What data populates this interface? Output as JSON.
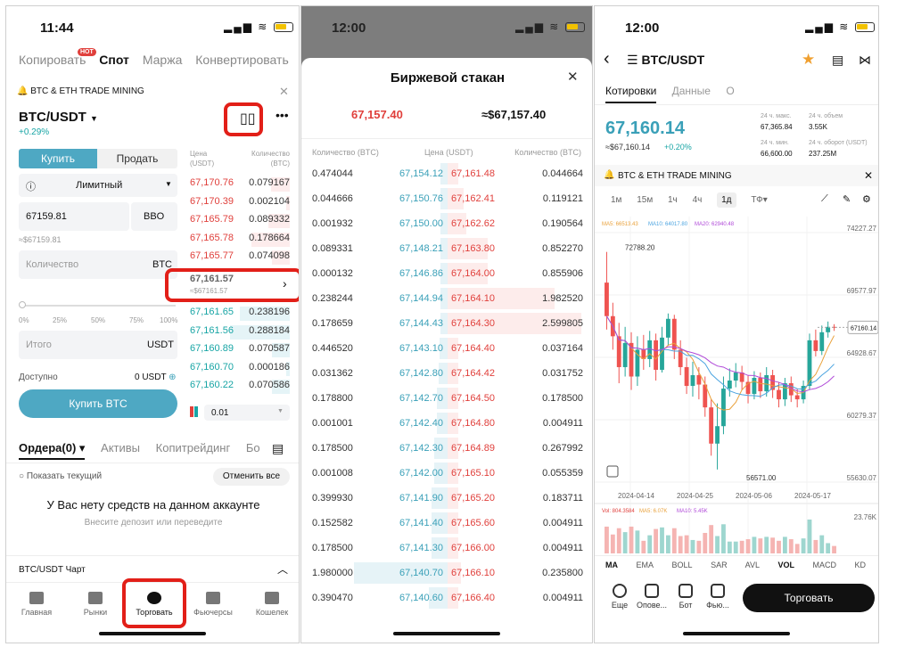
{
  "panel1": {
    "status": {
      "time": "11:44"
    },
    "nav": {
      "tabs": [
        "Копировать",
        "Спот",
        "Маржа",
        "Конвертировать"
      ],
      "active": "Спот",
      "hot": "HOT"
    },
    "banner": {
      "text": "BTC & ETH TRADE MINING"
    },
    "pair": {
      "name": "BTC/USDT",
      "change": "+0.29%"
    },
    "buy_sell": {
      "buy": "Купить",
      "sell": "Продать"
    },
    "order_type": "Лимитный",
    "price_input": {
      "value": "67159.81",
      "bbo": "BBO",
      "approx": "≈$67159.81"
    },
    "qty_input": {
      "placeholder": "Количество",
      "unit": "BTC"
    },
    "slider": {
      "marks": [
        "0%",
        "25%",
        "50%",
        "75%",
        "100%"
      ]
    },
    "total": {
      "placeholder": "Итого",
      "unit": "USDT"
    },
    "available": {
      "label": "Доступно",
      "value": "0 USDT"
    },
    "buy_button": "Купить BTC",
    "orderbook": {
      "header_price": "Цена (USDT)",
      "header_qty": "Количество (BTC)",
      "asks": [
        {
          "price": "67,170.76",
          "qty": "0.079167"
        },
        {
          "price": "67,170.39",
          "qty": "0.002104"
        },
        {
          "price": "67,165.79",
          "qty": "0.089332"
        },
        {
          "price": "67,165.78",
          "qty": "0.178664"
        },
        {
          "price": "67,165.77",
          "qty": "0.074098"
        }
      ],
      "mid": {
        "price": "67,161.57",
        "approx": "≈$67161.57"
      },
      "bids": [
        {
          "price": "67,161.65",
          "qty": "0.238196"
        },
        {
          "price": "67,161.56",
          "qty": "0.288184"
        },
        {
          "price": "67,160.89",
          "qty": "0.070587"
        },
        {
          "price": "67,160.70",
          "qty": "0.000186"
        },
        {
          "price": "67,160.22",
          "qty": "0.070586"
        }
      ],
      "step": "0.01"
    },
    "orders_tabs": [
      "Ордера(0)",
      "Активы",
      "Копитрейдинг",
      "Бо"
    ],
    "show_current": "Показать текущий",
    "cancel_all": "Отменить все",
    "empty_title": "У Вас нету средств на данном аккаунте",
    "empty_sub": "Внесите депозит или переведите",
    "chart_bar": "BTC/USDT Чарт",
    "tabbar": [
      "Главная",
      "Рынки",
      "Торговать",
      "Фьючерсы",
      "Кошелек"
    ]
  },
  "panel2": {
    "status": {
      "time": "12:00"
    },
    "title": "Биржевой стакан",
    "last_price": "67,157.40",
    "last_usd": "≈$67,157.40",
    "headers": {
      "left": "Количество (BTC)",
      "mid": "Цена (USDT)",
      "right": "Количество (BTC)"
    },
    "rows": [
      {
        "bq": "0.474044",
        "bp": "67,154.12",
        "ap": "67,161.48",
        "aq": "0.044664",
        "bw": 0.05,
        "aw": 0.08
      },
      {
        "bq": "0.044666",
        "bp": "67,150.76",
        "ap": "67,162.41",
        "aq": "0.119121",
        "bw": 0.05,
        "aw": 0.12
      },
      {
        "bq": "0.001932",
        "bp": "67,150.00",
        "ap": "67,162.62",
        "aq": "0.190564",
        "bw": 0.05,
        "aw": 0.14
      },
      {
        "bq": "0.089331",
        "bp": "67,148.21",
        "ap": "67,163.80",
        "aq": "0.852270",
        "bw": 0.05,
        "aw": 0.3
      },
      {
        "bq": "0.000132",
        "bp": "67,146.86",
        "ap": "67,164.00",
        "aq": "0.855906",
        "bw": 0.05,
        "aw": 0.3
      },
      {
        "bq": "0.238244",
        "bp": "67,144.94",
        "ap": "67,164.10",
        "aq": "1.982520",
        "bw": 0.05,
        "aw": 0.8
      },
      {
        "bq": "0.178659",
        "bp": "67,144.43",
        "ap": "67,164.30",
        "aq": "2.599805",
        "bw": 0.05,
        "aw": 1.0
      },
      {
        "bq": "0.446520",
        "bp": "67,143.10",
        "ap": "67,164.40",
        "aq": "0.037164",
        "bw": 0.06,
        "aw": 0.08
      },
      {
        "bq": "0.031362",
        "bp": "67,142.80",
        "ap": "67,164.42",
        "aq": "0.031752",
        "bw": 0.07,
        "aw": 0.08
      },
      {
        "bq": "0.178800",
        "bp": "67,142.70",
        "ap": "67,164.50",
        "aq": "0.178500",
        "bw": 0.08,
        "aw": 0.08
      },
      {
        "bq": "0.001001",
        "bp": "67,142.40",
        "ap": "67,164.80",
        "aq": "0.004911",
        "bw": 0.08,
        "aw": 0.08
      },
      {
        "bq": "0.178500",
        "bp": "67,142.30",
        "ap": "67,164.89",
        "aq": "0.267992",
        "bw": 0.1,
        "aw": 0.08
      },
      {
        "bq": "0.001008",
        "bp": "67,142.00",
        "ap": "67,165.10",
        "aq": "0.055359",
        "bw": 0.1,
        "aw": 0.08
      },
      {
        "bq": "0.399930",
        "bp": "67,141.90",
        "ap": "67,165.20",
        "aq": "0.183711",
        "bw": 0.12,
        "aw": 0.08
      },
      {
        "bq": "0.152582",
        "bp": "67,141.40",
        "ap": "67,165.60",
        "aq": "0.004911",
        "bw": 0.12,
        "aw": 0.08
      },
      {
        "bq": "0.178500",
        "bp": "67,141.30",
        "ap": "67,166.00",
        "aq": "0.004911",
        "bw": 0.12,
        "aw": 0.08
      },
      {
        "bq": "1.980000",
        "bp": "67,140.70",
        "ap": "67,166.10",
        "aq": "0.235800",
        "bw": 0.7,
        "aw": 0.1
      },
      {
        "bq": "0.390470",
        "bp": "67,140.60",
        "ap": "67,166.40",
        "aq": "0.004911",
        "bw": 0.14,
        "aw": 0.08
      }
    ]
  },
  "panel3": {
    "status": {
      "time": "12:00"
    },
    "pair": "BTC/USDT",
    "tabs": [
      "Котировки",
      "Данные",
      "О"
    ],
    "price": "67,160.14",
    "price_usd": "≈$67,160.14",
    "change": "+0.20%",
    "stats": {
      "high_label": "24 ч. макс.",
      "high": "67,365.84",
      "vol_label": "24 ч. объем",
      "vol": "3.55K",
      "low_label": "24 ч. мин.",
      "low": "66,600.00",
      "turn_label": "24 ч. оборот (USDT)",
      "turn": "237.25M"
    },
    "banner": "BTC & ETH TRADE MINING",
    "timeframes": [
      "1м",
      "15м",
      "1ч",
      "4ч",
      "1д",
      "ТФ▾"
    ],
    "active_tf": "1д",
    "ma_legend": [
      "MA5: 66513.43",
      "MA10: 64017.80",
      "MA20: 62940.48"
    ],
    "y_labels": [
      "74227.27",
      "69577.97",
      "64928.67",
      "60279.37",
      "55630.07"
    ],
    "current_price_tag": "67160.14",
    "max_label": "72788.20",
    "min_label": "56571.00",
    "x_labels": [
      "2024-04-14",
      "2024-04-25",
      "2024-05-06",
      "2024-05-17"
    ],
    "vol_legend": [
      "Vol: 804.3584",
      "MA5: 6.07K",
      "MA10: 5.45K"
    ],
    "vol_y": "23.76K",
    "indicators": [
      "MA",
      "EMA",
      "BOLL",
      "SAR",
      "AVL",
      "VOL",
      "MACD",
      "KD"
    ],
    "bottom_items": [
      "Еще",
      "Опове...",
      "Бот",
      "Фью..."
    ],
    "trade_button": "Торговать",
    "colors": {
      "up": "#26a69a",
      "down": "#ef5350"
    },
    "candles": [
      {
        "o": 70500,
        "c": 68000,
        "h": 72788,
        "l": 67000
      },
      {
        "o": 68000,
        "c": 66500,
        "h": 69000,
        "l": 65500
      },
      {
        "o": 66500,
        "c": 64200,
        "h": 67500,
        "l": 63000
      },
      {
        "o": 64200,
        "c": 66000,
        "h": 67200,
        "l": 63500
      },
      {
        "o": 66000,
        "c": 63500,
        "h": 66800,
        "l": 62500
      },
      {
        "o": 63500,
        "c": 65500,
        "h": 66500,
        "l": 62800
      },
      {
        "o": 65500,
        "c": 64800,
        "h": 66600,
        "l": 64000
      },
      {
        "o": 64800,
        "c": 66200,
        "h": 66900,
        "l": 64200
      },
      {
        "o": 66200,
        "c": 64000,
        "h": 66700,
        "l": 63200
      },
      {
        "o": 64000,
        "c": 66400,
        "h": 67200,
        "l": 63800
      },
      {
        "o": 66400,
        "c": 67800,
        "h": 68200,
        "l": 65800
      },
      {
        "o": 67800,
        "c": 65500,
        "h": 68100,
        "l": 64800
      },
      {
        "o": 65500,
        "c": 64200,
        "h": 66200,
        "l": 63600
      },
      {
        "o": 64200,
        "c": 62800,
        "h": 64900,
        "l": 62200
      },
      {
        "o": 62800,
        "c": 63600,
        "h": 64600,
        "l": 62000
      },
      {
        "o": 63600,
        "c": 62900,
        "h": 64200,
        "l": 61800
      },
      {
        "o": 62900,
        "c": 61200,
        "h": 63500,
        "l": 60500
      },
      {
        "o": 61200,
        "c": 58500,
        "h": 61800,
        "l": 57600
      },
      {
        "o": 58500,
        "c": 59800,
        "h": 61500,
        "l": 56571
      },
      {
        "o": 59800,
        "c": 62600,
        "h": 63500,
        "l": 59200
      },
      {
        "o": 62600,
        "c": 63200,
        "h": 64100,
        "l": 62000
      },
      {
        "o": 63200,
        "c": 63800,
        "h": 64500,
        "l": 62700
      },
      {
        "o": 63800,
        "c": 63100,
        "h": 64300,
        "l": 62500
      },
      {
        "o": 63100,
        "c": 62200,
        "h": 63600,
        "l": 61500
      },
      {
        "o": 62200,
        "c": 63400,
        "h": 63900,
        "l": 61800
      },
      {
        "o": 63400,
        "c": 62400,
        "h": 63800,
        "l": 61900
      },
      {
        "o": 62400,
        "c": 63600,
        "h": 64200,
        "l": 62000
      },
      {
        "o": 63600,
        "c": 62500,
        "h": 64000,
        "l": 61900
      },
      {
        "o": 62500,
        "c": 61800,
        "h": 63100,
        "l": 61200
      },
      {
        "o": 61800,
        "c": 63000,
        "h": 63400,
        "l": 61300
      },
      {
        "o": 63000,
        "c": 62100,
        "h": 63500,
        "l": 61600
      },
      {
        "o": 62100,
        "c": 61800,
        "h": 62600,
        "l": 61200
      },
      {
        "o": 61800,
        "c": 62800,
        "h": 63200,
        "l": 61500
      },
      {
        "o": 62800,
        "c": 66200,
        "h": 66700,
        "l": 62500
      },
      {
        "o": 66200,
        "c": 65400,
        "h": 67000,
        "l": 65000
      },
      {
        "o": 65400,
        "c": 66800,
        "h": 67300,
        "l": 65100
      },
      {
        "o": 66800,
        "c": 67200,
        "h": 67600,
        "l": 66400
      },
      {
        "o": 67200,
        "c": 67160,
        "h": 67400,
        "l": 66900
      }
    ]
  }
}
